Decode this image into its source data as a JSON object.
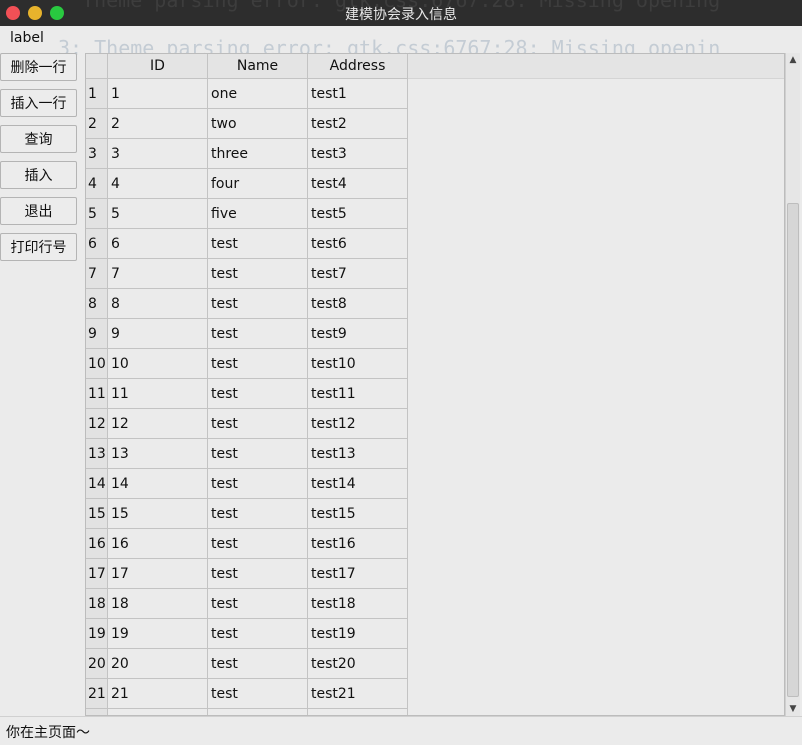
{
  "window": {
    "title": "建模协会录入信息",
    "background_terminal_line": "'Theme parsing error: gtk.css:6767:28: Missing opening",
    "terminal_overlay_line": "3: Theme parsing error: gtk.css:6767:28: Missing openin"
  },
  "top_label": "label",
  "buttons": {
    "delete_row": "删除一行",
    "insert_row": "插入一行",
    "query": "查询",
    "insert": "插入",
    "exit": "退出",
    "print_row_number": "打印行号"
  },
  "table": {
    "columns": [
      "ID",
      "Name",
      "Address"
    ],
    "rows": [
      {
        "num": "1",
        "id": "1",
        "name": "one",
        "address": "test1"
      },
      {
        "num": "2",
        "id": "2",
        "name": "two",
        "address": "test2"
      },
      {
        "num": "3",
        "id": "3",
        "name": "three",
        "address": "test3"
      },
      {
        "num": "4",
        "id": "4",
        "name": "four",
        "address": "test4"
      },
      {
        "num": "5",
        "id": "5",
        "name": "five",
        "address": "test5"
      },
      {
        "num": "6",
        "id": "6",
        "name": "test",
        "address": "test6"
      },
      {
        "num": "7",
        "id": "7",
        "name": "test",
        "address": "test7"
      },
      {
        "num": "8",
        "id": "8",
        "name": "test",
        "address": "test8"
      },
      {
        "num": "9",
        "id": "9",
        "name": "test",
        "address": "test9"
      },
      {
        "num": "10",
        "id": "10",
        "name": "test",
        "address": "test10"
      },
      {
        "num": "11",
        "id": "11",
        "name": "test",
        "address": "test11"
      },
      {
        "num": "12",
        "id": "12",
        "name": "test",
        "address": "test12"
      },
      {
        "num": "13",
        "id": "13",
        "name": "test",
        "address": "test13"
      },
      {
        "num": "14",
        "id": "14",
        "name": "test",
        "address": "test14"
      },
      {
        "num": "15",
        "id": "15",
        "name": "test",
        "address": "test15"
      },
      {
        "num": "16",
        "id": "16",
        "name": "test",
        "address": "test16"
      },
      {
        "num": "17",
        "id": "17",
        "name": "test",
        "address": "test17"
      },
      {
        "num": "18",
        "id": "18",
        "name": "test",
        "address": "test18"
      },
      {
        "num": "19",
        "id": "19",
        "name": "test",
        "address": "test19"
      },
      {
        "num": "20",
        "id": "20",
        "name": "test",
        "address": "test20"
      },
      {
        "num": "21",
        "id": "21",
        "name": "test",
        "address": "test21"
      }
    ]
  },
  "status_bar": "你在主页面～"
}
